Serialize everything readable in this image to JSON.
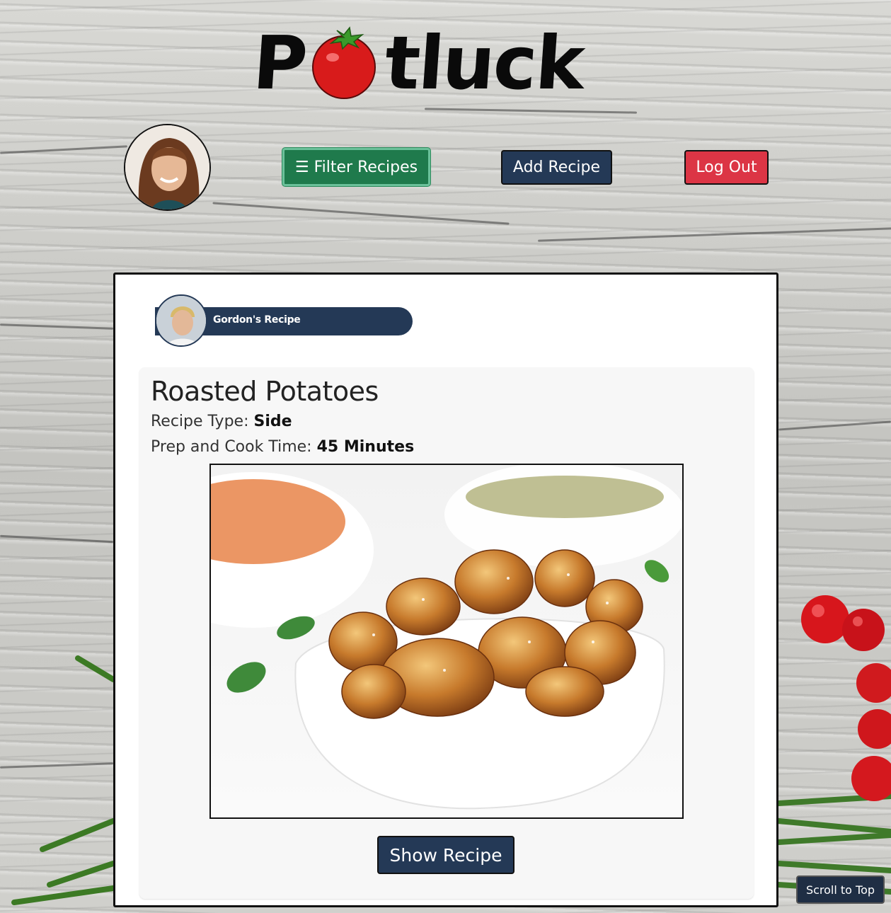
{
  "brand": {
    "logo_prefix": "P",
    "logo_suffix": "tluck"
  },
  "header": {
    "filter_label": "☰ Filter Recipes",
    "add_label": "Add Recipe",
    "logout_label": "Log Out"
  },
  "recipe": {
    "author_label": "Gordon's Recipe",
    "title": "Roasted Potatoes",
    "type_label": "Recipe Type:",
    "type_value": "Side",
    "time_label": "Prep and Cook Time:",
    "time_value": "45 Minutes",
    "show_label": "Show Recipe"
  },
  "footer": {
    "scroll_label": "Scroll to Top"
  },
  "colors": {
    "navy": "#243956",
    "green": "#1f7a4c",
    "red": "#dc3545"
  },
  "icons": {
    "logo_o": "tomato-icon"
  }
}
